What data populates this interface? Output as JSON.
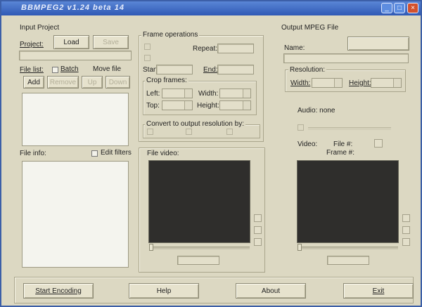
{
  "window": {
    "title": "BBMPEG2 v1.24 beta 14",
    "min": "_",
    "max": "□",
    "close": "×"
  },
  "input_project": {
    "group_label": "Input Project",
    "project_label": "Project:",
    "load_label": "Load",
    "save_label": "Save",
    "file_list_label": "File list:",
    "batch_label": "Batch",
    "move_file_label": "Move file",
    "add_label": "Add",
    "remove_label": "Remove",
    "up_label": "Up",
    "down_label": "Down",
    "file_info_label": "File info:",
    "edit_filters_label": "Edit filters"
  },
  "frame_ops": {
    "group_label": "Frame operations",
    "repeat_label": "Repeat:",
    "start_label": "Start:",
    "end_label": "End:",
    "crop_label": "Crop frames:",
    "left_label": "Left:",
    "width_label": "Width:",
    "top_label": "Top:",
    "height_label": "Height:",
    "convert_label": "Convert to output resolution by:",
    "file_video_label": "File video:"
  },
  "output": {
    "group_label": "Output MPEG File",
    "name_label": "Name:",
    "resolution_label": "Resolution:",
    "width_label": "Width:",
    "height_label": "Height:",
    "audio_label": "Audio: none",
    "video_label": "Video:",
    "file_num_label": "File #:",
    "frame_num_label": "Frame #:"
  },
  "bottom": {
    "start_encoding_label": "Start Encoding",
    "help_label": "Help",
    "about_label": "About",
    "exit_label": "Exit"
  }
}
